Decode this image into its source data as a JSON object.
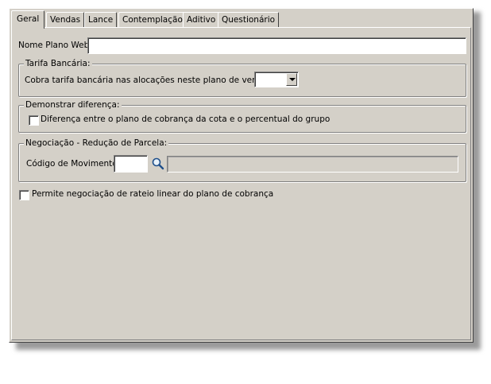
{
  "tabs": [
    {
      "label": "Geral",
      "active": true
    },
    {
      "label": "Vendas",
      "active": false
    },
    {
      "label": "Lance",
      "active": false
    },
    {
      "label": "Contemplação",
      "active": false
    },
    {
      "label": "Aditivo",
      "active": false
    },
    {
      "label": "Questionário",
      "active": false
    }
  ],
  "geral": {
    "nome_plano_web": {
      "label": "Nome Plano Web:",
      "value": ""
    },
    "tarifa_bancaria": {
      "legend": "Tarifa Bancária:",
      "label": "Cobra tarifa bancária nas alocações neste plano de venda:",
      "selected": ""
    },
    "demonstrar_diferenca": {
      "legend": "Demonstrar diferença:",
      "checkbox_label": "Diferença entre o plano de cobrança da cota e o percentual do grupo",
      "checked": false
    },
    "negociacao": {
      "legend": "Negociação - Redução de Parcela:",
      "codigo_label": "Código de Movimento:",
      "codigo_value": "",
      "descricao_value": "",
      "search_icon": "magnifier-icon"
    },
    "permite_rateio": {
      "label": "Permite negociação de rateio linear do plano de cobrança",
      "checked": false
    }
  }
}
